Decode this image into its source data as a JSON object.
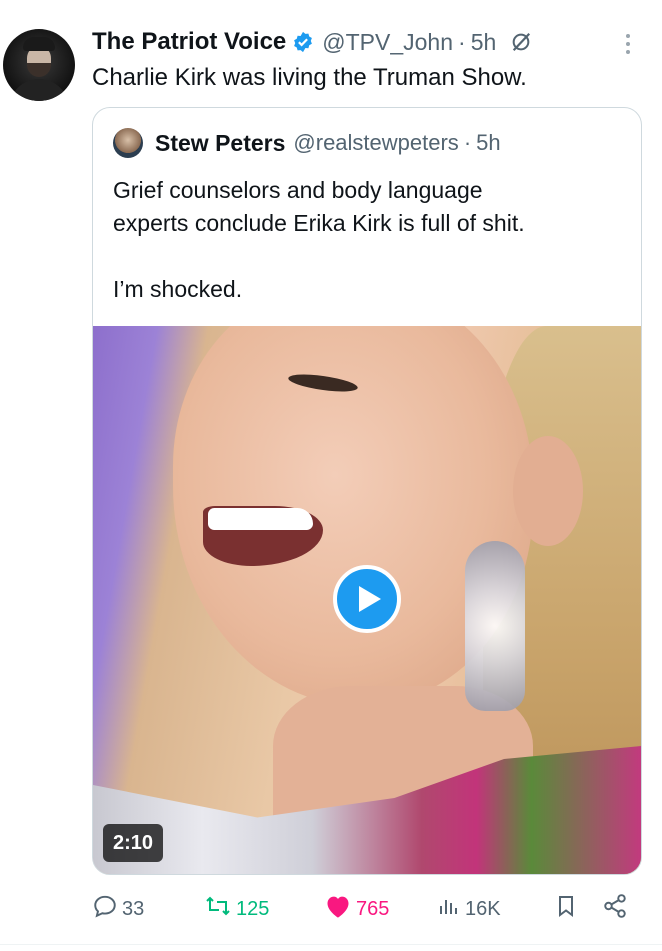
{
  "post": {
    "display_name": "The Patriot Voice",
    "handle": "@TPV_John",
    "separator": "·",
    "time": "5h",
    "text": "Charlie Kirk was living the Truman Show."
  },
  "quoted_post": {
    "display_name": "Stew Peters",
    "handle": "@realstewpeters",
    "separator": "·",
    "time": "5h",
    "text_lines": [
      "Grief counselors and body language",
      "experts conclude Erika Kirk is full of shit.",
      "I’m shocked."
    ],
    "video": {
      "duration": "2:10"
    }
  },
  "actions": {
    "replies": "33",
    "reposts": "125",
    "likes": "765",
    "views": "16K"
  },
  "colors": {
    "accent": "#1d9bf0",
    "repost_active": "#00ba7c",
    "like_active": "#f91880",
    "muted_text": "#536471"
  },
  "icons": [
    "verified-badge-icon",
    "grok-icon",
    "more-icon",
    "play-icon",
    "reply-icon",
    "repost-icon",
    "like-icon",
    "views-icon",
    "bookmark-icon",
    "share-icon"
  ]
}
